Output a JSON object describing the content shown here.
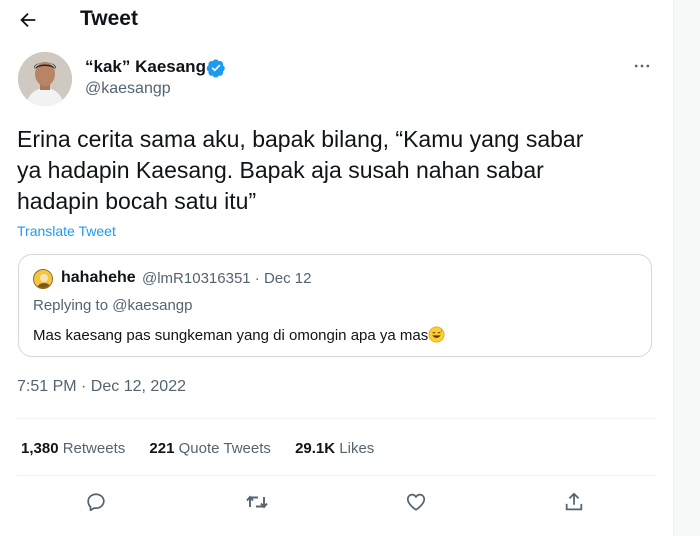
{
  "header": {
    "title": "Tweet"
  },
  "author": {
    "display_name": "“kak” Kaesang",
    "handle": "@kaesangp"
  },
  "tweet": {
    "text": "Erina cerita sama aku, bapak bilang, “Kamu yang sabar\nya hadapin Kaesang. Bapak aja susah nahan sabar\nhadapin bocah satu itu”",
    "translate_label": "Translate Tweet",
    "timestamp": "7:51 PM · Dec 12, 2022"
  },
  "quote": {
    "name": "hahahehe",
    "meta": "@lmR10316351 · Dec 12",
    "replying_to": "Replying to @kaesangp",
    "text": "Mas kaesang pas sungkeman yang di omongin apa ya mas"
  },
  "stats": {
    "retweets_count": "1,380",
    "retweets_label": "Retweets",
    "quotes_count": "221",
    "quotes_label": "Quote Tweets",
    "likes_count": "29.1K",
    "likes_label": "Likes"
  },
  "colors": {
    "accent": "#1d9bf0",
    "text": "#0f1419",
    "muted": "#536471",
    "border": "#cfd9de"
  },
  "icons": [
    "back-arrow-icon",
    "verified-badge-icon",
    "more-icon",
    "reply-icon",
    "retweet-icon",
    "like-icon",
    "share-icon",
    "sweat-smile-emoji"
  ]
}
